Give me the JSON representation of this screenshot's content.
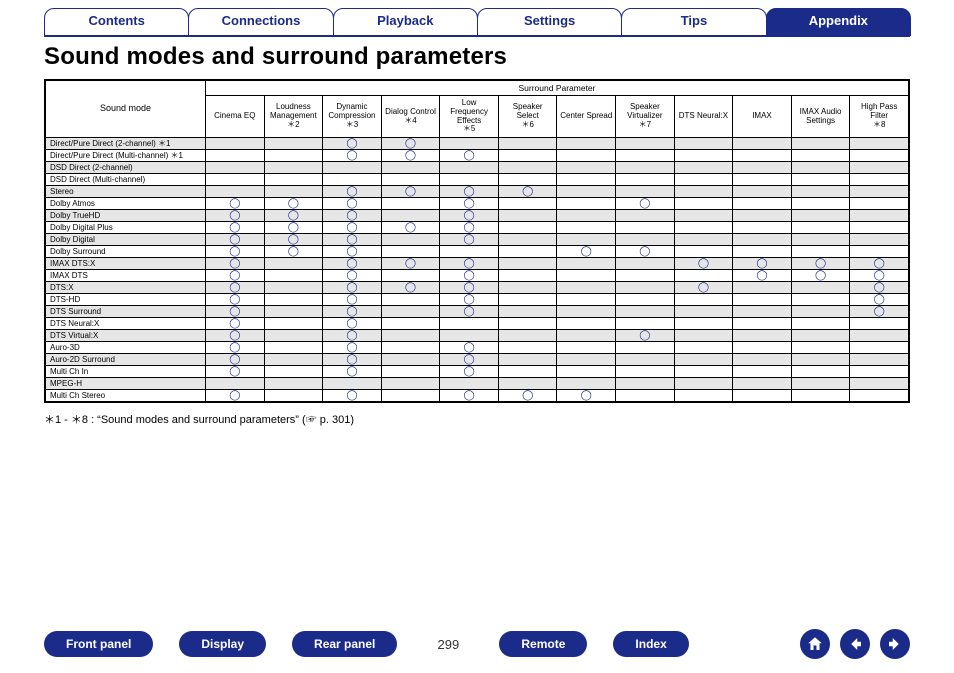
{
  "tabs": {
    "items": [
      "Contents",
      "Connections",
      "Playback",
      "Settings",
      "Tips",
      "Appendix"
    ],
    "activeIndex": 5
  },
  "title": "Sound modes and surround parameters",
  "table": {
    "soundmode_header": "Sound mode",
    "group_header": "Surround Parameter",
    "columns": [
      {
        "label": "Cinema EQ",
        "star": ""
      },
      {
        "label": "Loudness Management",
        "star": "＊2"
      },
      {
        "label": "Dynamic Compression",
        "star": "＊3"
      },
      {
        "label": "Dialog Control",
        "star": "＊4"
      },
      {
        "label": "Low Frequency Effects",
        "star": "＊5"
      },
      {
        "label": "Speaker Select",
        "star": "＊6"
      },
      {
        "label": "Center Spread",
        "star": ""
      },
      {
        "label": "Speaker Virtualizer",
        "star": "＊7"
      },
      {
        "label": "DTS Neural:X",
        "star": ""
      },
      {
        "label": "IMAX",
        "star": ""
      },
      {
        "label": "IMAX Audio Settings",
        "star": ""
      },
      {
        "label": "High Pass Filter",
        "star": "＊8"
      }
    ],
    "rows": [
      {
        "name": "Direct/Pure Direct (2-channel) ＊1",
        "c": [
          "",
          "",
          "◯",
          "◯",
          "",
          "",
          "",
          "",
          "",
          "",
          "",
          ""
        ]
      },
      {
        "name": "Direct/Pure Direct (Multi-channel) ＊1",
        "c": [
          "",
          "",
          "◯",
          "◯",
          "◯",
          "",
          "",
          "",
          "",
          "",
          "",
          ""
        ]
      },
      {
        "name": "DSD Direct (2-channel)",
        "c": [
          "",
          "",
          "",
          "",
          "",
          "",
          "",
          "",
          "",
          "",
          "",
          ""
        ]
      },
      {
        "name": "DSD Direct (Multi-channel)",
        "c": [
          "",
          "",
          "",
          "",
          "",
          "",
          "",
          "",
          "",
          "",
          "",
          ""
        ]
      },
      {
        "name": "Stereo",
        "c": [
          "",
          "",
          "◯",
          "◯",
          "◯",
          "◯",
          "",
          "",
          "",
          "",
          "",
          ""
        ]
      },
      {
        "name": "Dolby Atmos",
        "c": [
          "◯",
          "◯",
          "◯",
          "",
          "◯",
          "",
          "",
          "◯",
          "",
          "",
          "",
          ""
        ]
      },
      {
        "name": "Dolby TrueHD",
        "c": [
          "◯",
          "◯",
          "◯",
          "",
          "◯",
          "",
          "",
          "",
          "",
          "",
          "",
          ""
        ]
      },
      {
        "name": "Dolby Digital Plus",
        "c": [
          "◯",
          "◯",
          "◯",
          "◯",
          "◯",
          "",
          "",
          "",
          "",
          "",
          "",
          ""
        ]
      },
      {
        "name": "Dolby Digital",
        "c": [
          "◯",
          "◯",
          "◯",
          "",
          "◯",
          "",
          "",
          "",
          "",
          "",
          "",
          ""
        ]
      },
      {
        "name": "Dolby Surround",
        "c": [
          "◯",
          "◯",
          "◯",
          "",
          "",
          "",
          "◯",
          "◯",
          "",
          "",
          "",
          ""
        ]
      },
      {
        "name": "IMAX DTS:X",
        "c": [
          "◯",
          "",
          "◯",
          "◯",
          "◯",
          "",
          "",
          "",
          "◯",
          "◯",
          "◯",
          "◯"
        ]
      },
      {
        "name": "IMAX DTS",
        "c": [
          "◯",
          "",
          "◯",
          "",
          "◯",
          "",
          "",
          "",
          "",
          "◯",
          "◯",
          "◯"
        ]
      },
      {
        "name": "DTS:X",
        "c": [
          "◯",
          "",
          "◯",
          "◯",
          "◯",
          "",
          "",
          "",
          "◯",
          "",
          "",
          "◯"
        ]
      },
      {
        "name": "DTS-HD",
        "c": [
          "◯",
          "",
          "◯",
          "",
          "◯",
          "",
          "",
          "",
          "",
          "",
          "",
          "◯"
        ]
      },
      {
        "name": "DTS Surround",
        "c": [
          "◯",
          "",
          "◯",
          "",
          "◯",
          "",
          "",
          "",
          "",
          "",
          "",
          "◯"
        ]
      },
      {
        "name": "DTS Neural:X",
        "c": [
          "◯",
          "",
          "◯",
          "",
          "",
          "",
          "",
          "",
          "",
          "",
          "",
          ""
        ]
      },
      {
        "name": "DTS Virtual:X",
        "c": [
          "◯",
          "",
          "◯",
          "",
          "",
          "",
          "",
          "◯",
          "",
          "",
          "",
          ""
        ]
      },
      {
        "name": "Auro-3D",
        "c": [
          "◯",
          "",
          "◯",
          "",
          "◯",
          "",
          "",
          "",
          "",
          "",
          "",
          ""
        ]
      },
      {
        "name": "Auro-2D Surround",
        "c": [
          "◯",
          "",
          "◯",
          "",
          "◯",
          "",
          "",
          "",
          "",
          "",
          "",
          ""
        ]
      },
      {
        "name": "Multi Ch In",
        "c": [
          "◯",
          "",
          "◯",
          "",
          "◯",
          "",
          "",
          "",
          "",
          "",
          "",
          ""
        ]
      },
      {
        "name": "MPEG-H",
        "c": [
          "",
          "",
          "",
          "",
          "",
          "",
          "",
          "",
          "",
          "",
          "",
          ""
        ]
      },
      {
        "name": "Multi Ch Stereo",
        "c": [
          "◯",
          "",
          "◯",
          "",
          "◯",
          "◯",
          "◯",
          "",
          "",
          "",
          "",
          ""
        ]
      }
    ]
  },
  "footnote": "＊1 - ＊8 : “Sound modes and surround parameters” (☞ p. 301)",
  "bottom": {
    "buttons": [
      "Front panel",
      "Display",
      "Rear panel"
    ],
    "page": "299",
    "buttons2": [
      "Remote",
      "Index"
    ]
  }
}
